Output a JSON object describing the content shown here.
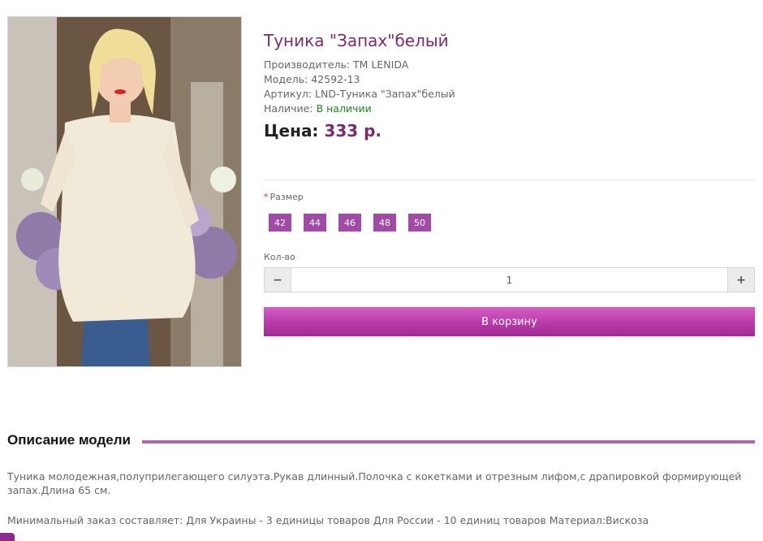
{
  "product": {
    "title": "Туника \"Запах\"белый",
    "manufacturer": "Производитель: TM LENIDA",
    "model": "Модель: 42592-13",
    "article": "Артикул: LND-Туника \"Запах\"белый",
    "availability_label": "Наличие: ",
    "availability_value": "В наличии",
    "price_label": "Цена: ",
    "price_value": "333 р."
  },
  "options": {
    "required_mark": "*",
    "size_label": "Размер",
    "sizes": [
      "42",
      "44",
      "46",
      "48",
      "50"
    ],
    "qty_label": "Кол-во",
    "qty_value": "1",
    "minus": "−",
    "plus": "+"
  },
  "cart_button": "В корзину",
  "description": {
    "title": "Описание модели",
    "paragraph1": "Туника молодежная,полуприлегающего силуэта.Рукав длинный.Полочка с кокетками и отрезным лифом,с драпировкой формирующей запах.Длина 65 см.",
    "paragraph2": "Минимальный заказ составляет: Для Украины - 3 единицы товаров Для России - 10 единиц товаров Материал:Вискоза"
  },
  "colors": {
    "title": "#7b2a6e",
    "accent": "#a24aa8",
    "in_stock": "#1a8a1a",
    "cart": "#b83aa8"
  }
}
